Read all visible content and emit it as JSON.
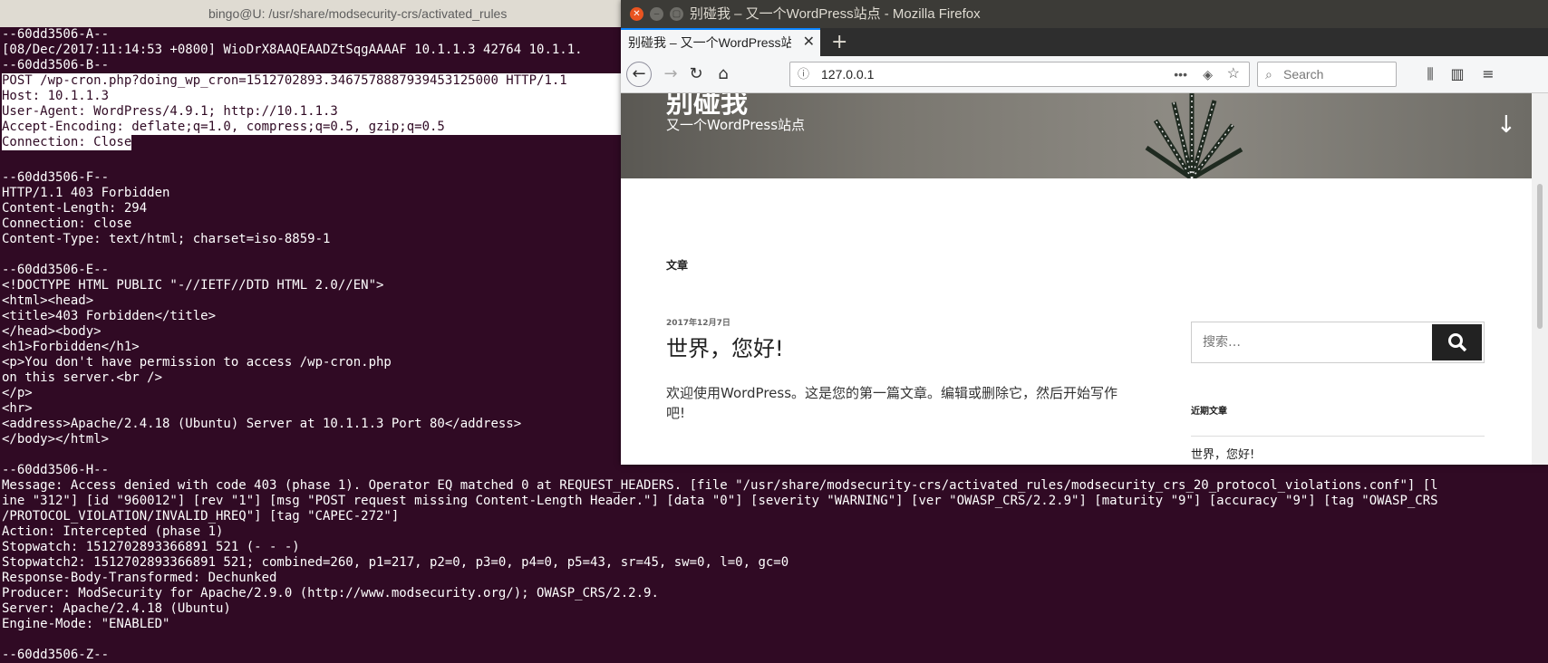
{
  "terminal": {
    "title": "bingo@U: /usr/share/modsecurity-crs/activated_rules",
    "lines": [
      "--60dd3506-A--",
      "[08/Dec/2017:11:14:53 +0800] WioDrX8AAQEAADZtSqgAAAAF 10.1.1.3 42764 10.1.1.",
      "--60dd3506-B--",
      "POST /wp-cron.php?doing_wp_cron=1512702893.3467578887939453125000 HTTP/1.1",
      "Host: 10.1.1.3",
      "User-Agent: WordPress/4.9.1; http://10.1.1.3",
      "Accept-Encoding: deflate;q=1.0, compress;q=0.5, gzip;q=0.5",
      "Connection: Close",
      "",
      "--60dd3506-F--",
      "HTTP/1.1 403 Forbidden",
      "Content-Length: 294",
      "Connection: close",
      "Content-Type: text/html; charset=iso-8859-1",
      "",
      "--60dd3506-E--",
      "<!DOCTYPE HTML PUBLIC \"-//IETF//DTD HTML 2.0//EN\">",
      "<html><head>",
      "<title>403 Forbidden</title>",
      "</head><body>",
      "<h1>Forbidden</h1>",
      "<p>You don't have permission to access /wp-cron.php",
      "on this server.<br />",
      "</p>",
      "<hr>",
      "<address>Apache/2.4.18 (Ubuntu) Server at 10.1.1.3 Port 80</address>",
      "</body></html>",
      "",
      "--60dd3506-H--",
      "Message: Access denied with code 403 (phase 1). Operator EQ matched 0 at REQUEST_HEADERS. [file \"/usr/share/modsecurity-crs/activated_rules/modsecurity_crs_20_protocol_violations.conf\"] [l",
      "ine \"312\"] [id \"960012\"] [rev \"1\"] [msg \"POST request missing Content-Length Header.\"] [data \"0\"] [severity \"WARNING\"] [ver \"OWASP_CRS/2.2.9\"] [maturity \"9\"] [accuracy \"9\"] [tag \"OWASP_CRS",
      "/PROTOCOL_VIOLATION/INVALID_HREQ\"] [tag \"CAPEC-272\"]",
      "Action: Intercepted (phase 1)",
      "Stopwatch: 1512702893366891 521 (- - -)",
      "Stopwatch2: 1512702893366891 521; combined=260, p1=217, p2=0, p3=0, p4=0, p5=43, sr=45, sw=0, l=0, gc=0",
      "Response-Body-Transformed: Dechunked",
      "Producer: ModSecurity for Apache/2.9.0 (http://www.modsecurity.org/); OWASP_CRS/2.2.9.",
      "Server: Apache/2.4.18 (Ubuntu)",
      "Engine-Mode: \"ENABLED\"",
      "",
      "--60dd3506-Z--"
    ]
  },
  "firefox": {
    "window_title": "别碰我 – 又一个WordPress站点 - Mozilla Firefox",
    "tab_label": "别碰我 – 又一个WordPress站点",
    "url": "127.0.0.1",
    "search_placeholder": "Search"
  },
  "page": {
    "site_title": "别碰我",
    "tagline": "又一个WordPress站点",
    "section_title": "文章",
    "post_date": "2017年12月7日",
    "post_title": "世界，您好!",
    "post_body": "欢迎使用WordPress。这是您的第一篇文章。编辑或删除它，然后开始写作吧!",
    "search_placeholder": "搜索…",
    "recent_heading": "近期文章",
    "recent_item": "世界，您好!"
  }
}
